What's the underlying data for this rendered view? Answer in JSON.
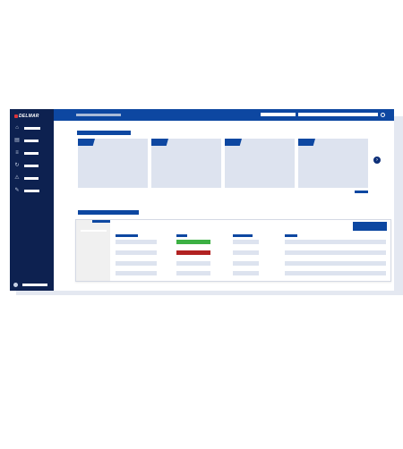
{
  "app": {
    "brand": "DELMAR"
  },
  "sidebar": {
    "items": [
      {
        "icon": "home-icon"
      },
      {
        "icon": "chart-icon"
      },
      {
        "icon": "list-icon"
      },
      {
        "icon": "refresh-icon"
      },
      {
        "icon": "warning-icon"
      },
      {
        "icon": "tools-icon"
      }
    ],
    "user": {
      "icon": "user-icon"
    }
  },
  "topbar": {
    "icon": "search-icon"
  },
  "main": {
    "cards": [
      {},
      {},
      {},
      {}
    ],
    "carousel_icon": "chevron-right-icon"
  },
  "colors": {
    "sidebar_bg": "#0d2150",
    "accent": "#0d47a1",
    "placeholder": "#dde3ef",
    "status_green": "#3cb043",
    "status_red": "#b22222"
  }
}
